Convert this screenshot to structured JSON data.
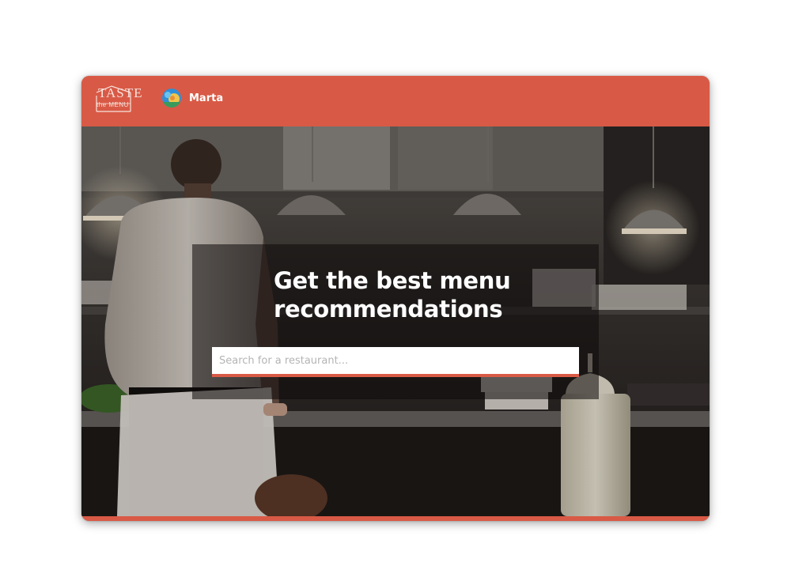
{
  "app": {
    "logo": {
      "line1": "TASTE",
      "line2": "the MENU"
    },
    "user": {
      "name": "Marta"
    }
  },
  "hero": {
    "headline": "Get the best menu recommendations",
    "search": {
      "placeholder": "Search for a restaurant...",
      "value": ""
    }
  },
  "colors": {
    "accent": "#d85a46",
    "overlay": "rgba(12,10,10,0.55)",
    "headline": "#ffffff"
  },
  "icons": {
    "logo": "taste-the-menu-logo",
    "avatar": "user-avatar-icon"
  }
}
